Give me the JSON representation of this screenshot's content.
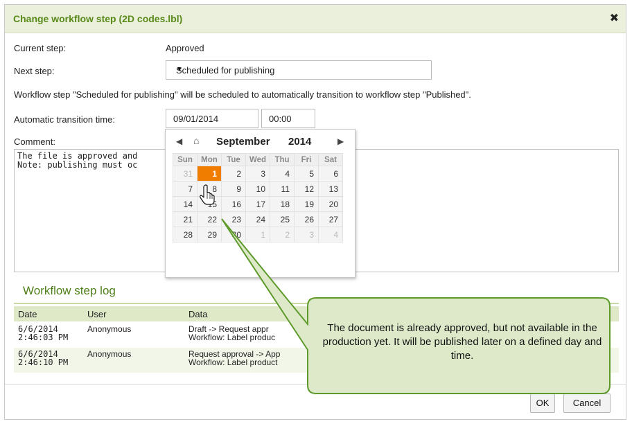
{
  "dialog": {
    "title": "Change workflow step (2D codes.lbl)",
    "close_glyph": "✖"
  },
  "form": {
    "current_step_label": "Current step:",
    "current_step_value": "Approved",
    "next_step_label": "Next step:",
    "next_step_value": "Scheduled for publishing",
    "info_text": "Workflow step \"Scheduled for publishing\" will be scheduled to automatically transition to workflow step \"Published\".",
    "transition_label": "Automatic transition time:",
    "transition_date": "09/01/2014",
    "transition_time": "00:00",
    "comment_label": "Comment:",
    "comment_value": "The file is approved and\nNote: publishing must oc"
  },
  "calendar": {
    "month": "September",
    "year": "2014",
    "weekdays": [
      "Sun",
      "Mon",
      "Tue",
      "Wed",
      "Thu",
      "Fri",
      "Sat"
    ],
    "weeks": [
      [
        "31",
        "1",
        "2",
        "3",
        "4",
        "5",
        "6"
      ],
      [
        "7",
        "8",
        "9",
        "10",
        "11",
        "12",
        "13"
      ],
      [
        "14",
        "15",
        "16",
        "17",
        "18",
        "19",
        "20"
      ],
      [
        "21",
        "22",
        "23",
        "24",
        "25",
        "26",
        "27"
      ],
      [
        "28",
        "29",
        "30",
        "1",
        "2",
        "3",
        "4"
      ]
    ],
    "selected": "1",
    "accent_color": "#f07c00"
  },
  "log": {
    "title": "Workflow step log",
    "columns": [
      "Date",
      "User",
      "Data"
    ],
    "rows": [
      {
        "date": "6/6/2014\n2:46:03 PM",
        "user": "Anonymous",
        "data": "Draft -> Request appr\nWorkflow: Label produc"
      },
      {
        "date": "6/6/2014\n2:46:10 PM",
        "user": "Anonymous",
        "data": "Request approval -> App\nWorkflow: Label product"
      }
    ]
  },
  "callout": {
    "text": "The document is already approved, but not available in the production yet. It will be published later on a defined day and time."
  },
  "buttons": {
    "ok": "OK",
    "cancel": "Cancel"
  },
  "colors": {
    "title_green": "#5a8a1a",
    "callout_border": "#4e8a1e"
  }
}
